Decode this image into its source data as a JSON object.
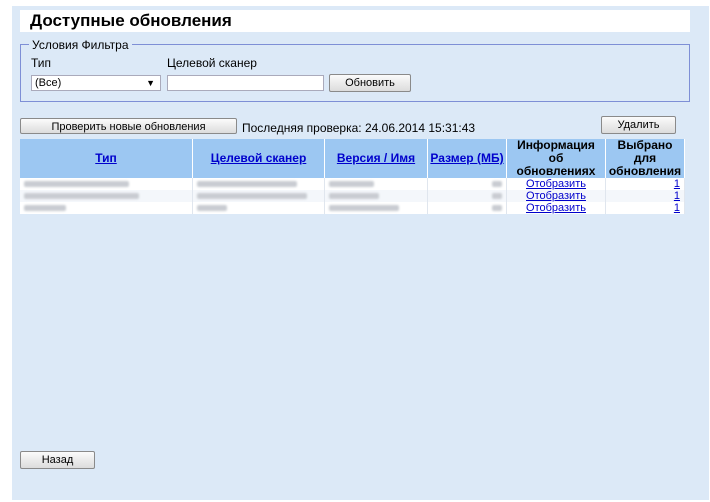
{
  "page": {
    "title": "Доступные обновления"
  },
  "filter": {
    "legend": "Условия Фильтра",
    "type_label": "Тип",
    "scanner_label": "Целевой сканер",
    "type_value": "(Все)",
    "scanner_value": "",
    "refresh_button": "Обновить"
  },
  "toolbar": {
    "check_button": "Проверить новые обновления немедленно",
    "last_check": "Последняя проверка: 24.06.2014 15:31:43",
    "delete_button": "Удалить"
  },
  "table": {
    "headers": {
      "type": "Тип",
      "scanner": "Целевой сканер",
      "version": "Версия / Имя",
      "size": "Размер (МБ)",
      "info": "Информация об обновлениях",
      "selected": "Выбрано для обновления"
    },
    "rows": [
      {
        "info": "Отобразить",
        "selected": "1"
      },
      {
        "info": "Отобразить",
        "selected": "1"
      },
      {
        "info": "Отобразить",
        "selected": "1"
      }
    ]
  },
  "footer": {
    "back_button": "Назад"
  }
}
